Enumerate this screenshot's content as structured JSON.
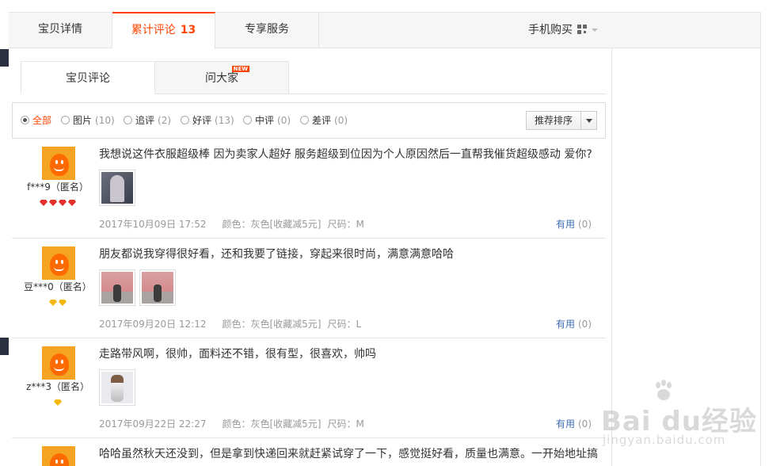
{
  "top_tabs": {
    "details": "宝贝详情",
    "reviews_label": "累计评论",
    "reviews_count": "13",
    "service": "专享服务",
    "mobile_buy": "手机购买"
  },
  "sub_tabs": {
    "reviews": "宝贝评论",
    "ask": "问大家",
    "new_badge": "NEW"
  },
  "filters": [
    {
      "label": "全部",
      "count": "",
      "active": true
    },
    {
      "label": "图片",
      "count": "(10)"
    },
    {
      "label": "追评",
      "count": "(2)"
    },
    {
      "label": "好评",
      "count": "(13)"
    },
    {
      "label": "中评",
      "count": "(0)"
    },
    {
      "label": "差评",
      "count": "(0)"
    }
  ],
  "sort": {
    "label": "推荐排序"
  },
  "reviews": [
    {
      "user": "f***9（匿名）",
      "text": "我想说这件衣服超级棒 因为卖家人超好 服务超级到位因为个人原因然后一直帮我催货超级感动 爱你?",
      "date": "2017年10月09日 17:52",
      "color": "颜色：灰色[收藏减5元]",
      "size": "尺码：M",
      "useful_label": "有用",
      "useful_count": "(0)"
    },
    {
      "user": "豆***0（匿名）",
      "text": "朋友都说我穿得很好看，还和我要了链接，穿起来很时尚，满意满意哈哈",
      "date": "2017年09月20日 12:12",
      "color": "颜色：灰色[收藏减5元]",
      "size": "尺码：L",
      "useful_label": "有用",
      "useful_count": "(0)"
    },
    {
      "user": "z***3（匿名）",
      "text": "走路带风啊，很帅，面料还不错，很有型，很喜欢，帅吗",
      "date": "2017年09月22日 22:27",
      "color": "颜色：灰色[收藏减5元]",
      "size": "尺码：M",
      "useful_label": "有用",
      "useful_count": "(0)"
    },
    {
      "text": "哈哈虽然秋天还没到，但是拿到快递回来就赶紧试穿了一下，感觉挺好看，质量也满意。一开始地址搞"
    }
  ],
  "watermark": {
    "brand": "Bai du经验",
    "url": "jingyan.baidu.com"
  }
}
